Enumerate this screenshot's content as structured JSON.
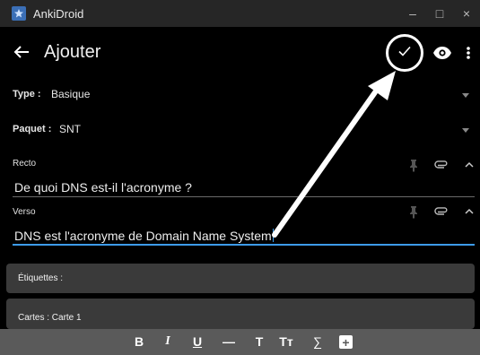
{
  "window": {
    "title": "AnkiDroid",
    "controls": [
      "–",
      "□",
      "×"
    ]
  },
  "appbar": {
    "title": "Ajouter",
    "icons": [
      "arrow-left-icon",
      "checkmark-icon",
      "eye-icon",
      "more-vert-icon"
    ]
  },
  "note_type": {
    "label": "Type :",
    "value": "Basique"
  },
  "deck": {
    "label": "Paquet :",
    "value": "SNT"
  },
  "fields": [
    {
      "label": "Recto",
      "value": "De quoi DNS est-il l'acronyme ?"
    },
    {
      "label": "Verso",
      "value": "DNS est l'acronyme de Domain Name System"
    }
  ],
  "tags": {
    "label": "Étiquettes :"
  },
  "cards": {
    "label": "Cartes : Carte 1"
  },
  "toolbar": {
    "bold": "B",
    "italic": "I",
    "underline": "U",
    "hr": "—",
    "title": "T",
    "font_size": "Tт",
    "mathjax": "∑",
    "add": "+"
  },
  "accent_color": "#3d9be9"
}
